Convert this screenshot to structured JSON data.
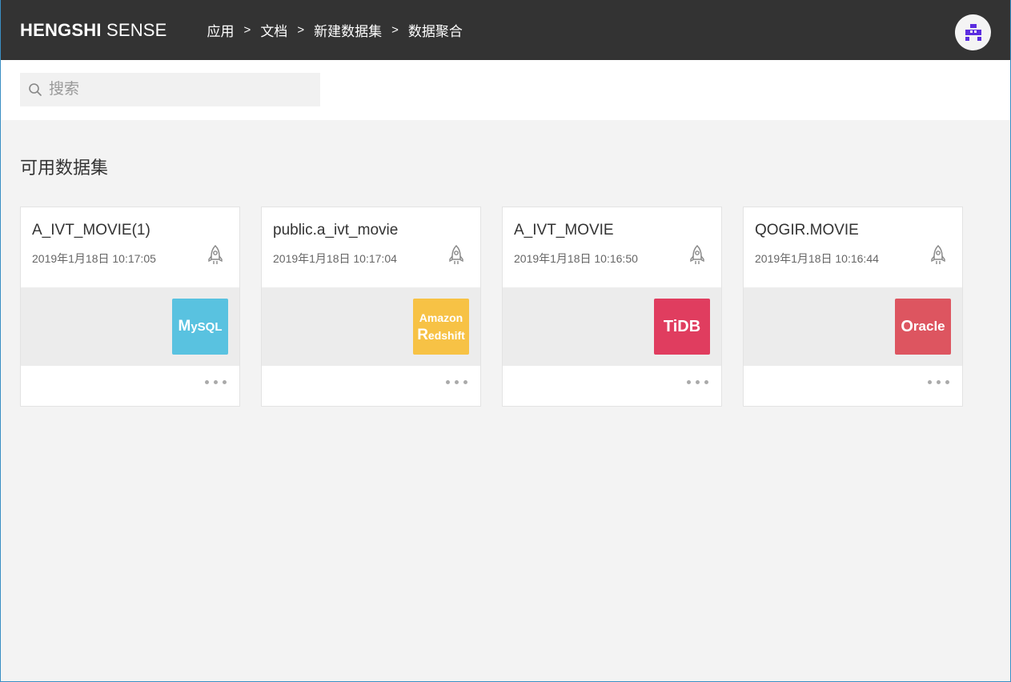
{
  "header": {
    "brand_strong": "HENGSHI",
    "brand_light": "SENSE",
    "breadcrumb": [
      "应用",
      "文档",
      "新建数据集",
      "数据聚合"
    ],
    "separator": ">",
    "avatar_icon": "pixel-avatar-icon"
  },
  "search": {
    "placeholder": "搜索",
    "value": "",
    "icon": "search-icon"
  },
  "main": {
    "section_title": "可用数据集",
    "datasets": [
      {
        "title": "A_IVT_MOVIE(1)",
        "date": "2019年1月18日 10:17:05",
        "source": "MySQL",
        "source_color": "#59c2e0"
      },
      {
        "title": "public.a_ivt_movie",
        "date": "2019年1月18日 10:17:04",
        "source": "Amazon Redshift",
        "source_color": "#f7c245"
      },
      {
        "title": "A_IVT_MOVIE",
        "date": "2019年1月18日 10:16:50",
        "source": "TiDB",
        "source_color": "#e03d5f"
      },
      {
        "title": "QOGIR.MOVIE",
        "date": "2019年1月18日 10:16:44",
        "source": "Oracle",
        "source_color": "#dd5560"
      }
    ],
    "logo_text": {
      "mysql_a": "M",
      "mysql_b": "y",
      "mysql_c": "SQL",
      "redshift_a": "Amazon",
      "redshift_b": "R",
      "redshift_c": "edshift",
      "tidb": "TiDB",
      "oracle_a": "O",
      "oracle_b": "racle"
    }
  },
  "colors": {
    "header_bg": "#333333",
    "page_bg": "#f3f3f3",
    "avatar_accent": "#5b2de0"
  }
}
